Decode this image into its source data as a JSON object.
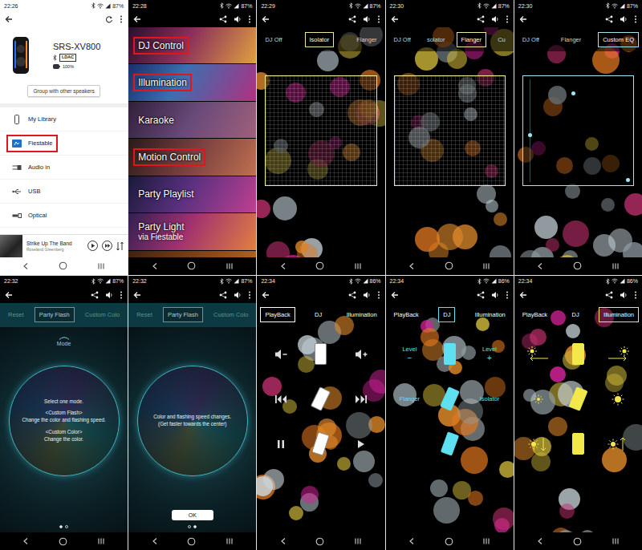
{
  "panels": [
    {
      "kind": "home",
      "time": "22:26",
      "battery": "87%",
      "device": {
        "name": "SRS-XV800",
        "codec": "LDAC",
        "battery": "100%"
      },
      "group_button": "Group with other speakers",
      "sources": [
        {
          "label": "My Library",
          "highlighted": false
        },
        {
          "label": "Fiestable",
          "highlighted": true
        },
        {
          "label": "Audio in",
          "highlighted": false
        },
        {
          "label": "USB",
          "highlighted": false
        },
        {
          "label": "Optical",
          "highlighted": false
        }
      ],
      "player": {
        "title": "Strike Up The Band",
        "artist": "Roseland Greenberg",
        "playing": false
      }
    },
    {
      "kind": "menu",
      "time": "22:28",
      "battery": "87%",
      "items": [
        {
          "label": "DJ Control",
          "highlighted": true
        },
        {
          "label": "Illumination",
          "highlighted": true
        },
        {
          "label": "Karaoke",
          "highlighted": false
        },
        {
          "label": "Motion Control",
          "highlighted": true
        },
        {
          "label": "Party Playlist",
          "highlighted": false
        },
        {
          "label": "Party Light",
          "sub": "via Fiestable",
          "highlighted": false
        }
      ]
    },
    {
      "kind": "dj",
      "time": "22:29",
      "battery": "87%",
      "color": "#ecea9a",
      "tabs": [
        {
          "label": "DJ Off",
          "selected": false
        },
        {
          "label": "Isolator",
          "selected": true
        },
        {
          "label": "Flanger",
          "selected": false
        }
      ],
      "pad": {
        "kind": "grid"
      }
    },
    {
      "kind": "dj",
      "time": "22:30",
      "battery": "87%",
      "color": "#ecea9a",
      "tabs": [
        {
          "label": "DJ Off",
          "selected": false
        },
        {
          "label": "solator",
          "selected": false
        },
        {
          "label": "Flanger",
          "selected": true
        },
        {
          "label": "Cu",
          "selected": false
        }
      ],
      "pad": {
        "kind": "grid"
      }
    },
    {
      "kind": "dj",
      "time": "22:30",
      "battery": "87%",
      "color": "#9fe6f0",
      "tabs": [
        {
          "label": "DJ Off",
          "selected": false
        },
        {
          "label": "Flanger",
          "selected": false
        },
        {
          "label": "Custom EQ",
          "selected": true
        }
      ],
      "pad": {
        "kind": "eq"
      }
    },
    {
      "kind": "illumination",
      "time": "22:32",
      "battery": "87%",
      "tabs": [
        {
          "label": "Reset",
          "selected": false
        },
        {
          "label": "Party Flash",
          "selected": true
        },
        {
          "label": "Custom Colo",
          "selected": false
        }
      ],
      "mode_label": "Mode",
      "circle_text": [
        [
          "Select one mode."
        ],
        [
          "<Custom Flash>",
          "Change the color and flashing speed."
        ],
        [
          "<Custom Color>",
          "Change the color."
        ]
      ],
      "pages": [
        {
          "selected": true
        },
        {
          "selected": false
        }
      ]
    },
    {
      "kind": "illumination",
      "time": "22:32",
      "battery": "87%",
      "tabs": [
        {
          "label": "Reset",
          "selected": false
        },
        {
          "label": "Party Flash",
          "selected": true
        },
        {
          "label": "Custom Colo",
          "selected": false
        }
      ],
      "circle_text": [
        [
          "Color and flashing speed changes.",
          "(Get faster towards the center)"
        ]
      ],
      "ok_button": "OK",
      "pages": [
        {
          "selected": false
        },
        {
          "selected": true
        }
      ]
    },
    {
      "kind": "motion",
      "time": "22:34",
      "battery": "86%",
      "color": "#ffffff",
      "tabs": [
        {
          "label": "PlayBack",
          "selected": true
        },
        {
          "label": "DJ",
          "selected": false
        },
        {
          "label": "Illumination",
          "selected": false
        }
      ]
    },
    {
      "kind": "motion",
      "time": "22:34",
      "battery": "86%",
      "color": "#5ee0f0",
      "tabs": [
        {
          "label": "PlayBack",
          "selected": false
        },
        {
          "label": "DJ",
          "selected": true
        },
        {
          "label": "Illumination",
          "selected": false
        }
      ],
      "rows": [
        {
          "left": "Level",
          "left_sign": "−",
          "right": "Level",
          "right_sign": "+"
        },
        {
          "left": "Flanger",
          "right": "Isolator"
        }
      ]
    },
    {
      "kind": "motion",
      "time": "22:34",
      "battery": "86%",
      "color": "#f2e84a",
      "tabs": [
        {
          "label": "PlayBack",
          "selected": false
        },
        {
          "label": "DJ",
          "selected": false
        },
        {
          "label": "Illumination",
          "selected": true
        }
      ]
    }
  ]
}
